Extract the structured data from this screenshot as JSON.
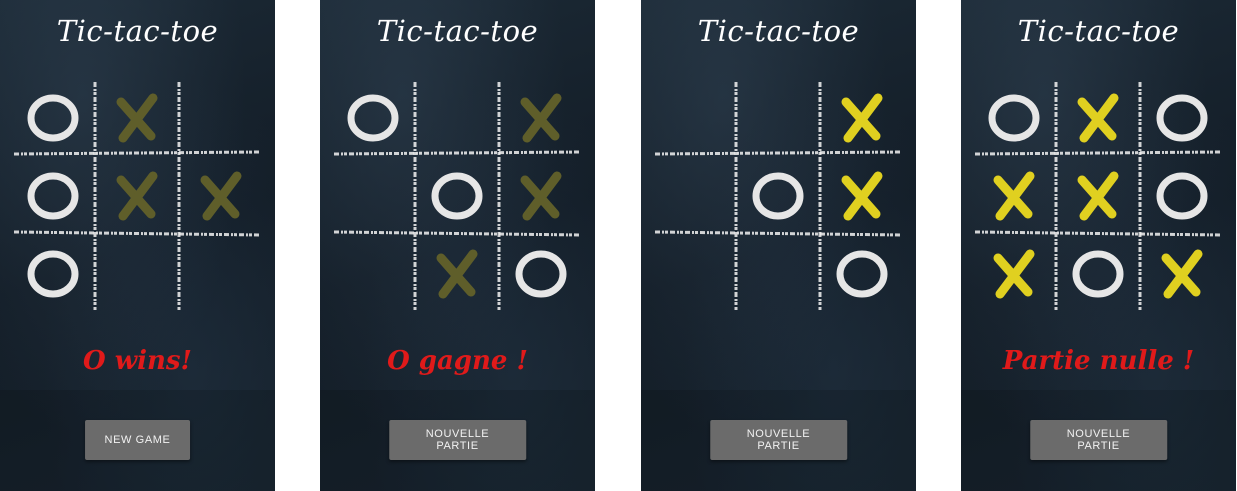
{
  "colors": {
    "result_text": "#e01a1a",
    "mark_o": "#e6e6e6",
    "mark_x_bright": "#e0d020",
    "mark_x_dim": "#5f5e2a",
    "button_bg": "#6b6b6b"
  },
  "screens": [
    {
      "title": "Tic-tac-toe",
      "board": [
        [
          "O",
          "x",
          ""
        ],
        [
          "O",
          "x",
          "x"
        ],
        [
          "O",
          "",
          ""
        ]
      ],
      "result": "O wins!",
      "button_label": "NEW GAME"
    },
    {
      "title": "Tic-tac-toe",
      "board": [
        [
          "O",
          "",
          "x"
        ],
        [
          "",
          "O",
          "x"
        ],
        [
          "",
          "x",
          "O"
        ]
      ],
      "result": "O gagne !",
      "button_label": "NOUVELLE PARTIE"
    },
    {
      "title": "Tic-tac-toe",
      "board": [
        [
          "",
          "",
          "X"
        ],
        [
          "",
          "O",
          "X"
        ],
        [
          "",
          "",
          "O"
        ]
      ],
      "result": "",
      "button_label": "NOUVELLE PARTIE"
    },
    {
      "title": "Tic-tac-toe",
      "board": [
        [
          "O",
          "X",
          "O"
        ],
        [
          "X",
          "X",
          "O"
        ],
        [
          "X",
          "O",
          "X"
        ]
      ],
      "result": "Partie nulle !",
      "button_label": "NOUVELLE PARTIE"
    }
  ],
  "legend": {
    "O": "o-mark",
    "X": "x-mark-bright",
    "x": "x-mark-dim"
  }
}
